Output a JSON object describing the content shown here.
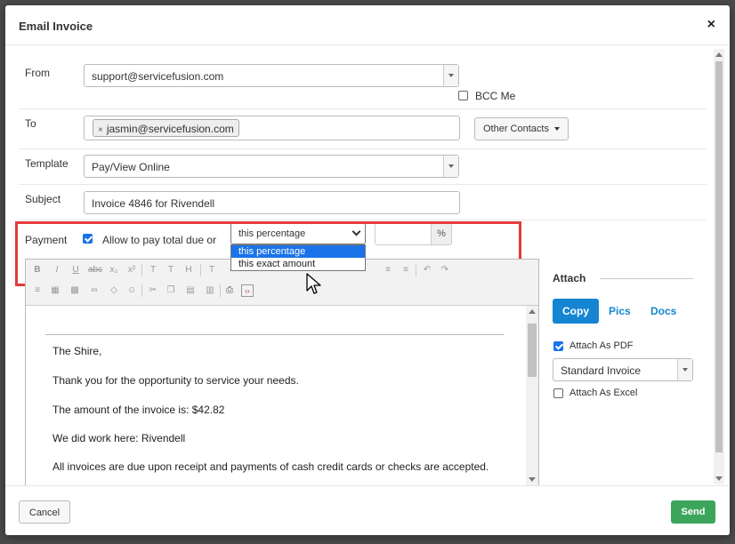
{
  "modal": {
    "title": "Email Invoice",
    "close_glyph": "×"
  },
  "from": {
    "label": "From",
    "value": "support@servicefusion.com",
    "bcc_label": "BCC Me",
    "bcc_checked": false
  },
  "to": {
    "label": "To",
    "recipient": "jasmin@servicefusion.com",
    "remove_glyph": "×",
    "other_contacts_label": "Other Contacts"
  },
  "template": {
    "label": "Template",
    "value": "Pay/View Online"
  },
  "subject": {
    "label": "Subject",
    "value": "Invoice 4846 for Rivendell"
  },
  "payment": {
    "label": "Payment",
    "allow_label": "Allow to pay total due or",
    "allow_checked": true,
    "mode_selected": "this percentage",
    "mode_options": [
      "this percentage",
      "this exact amount"
    ],
    "amount_value": "",
    "percent_addon": "%"
  },
  "editor": {
    "paragraphs": [
      "The Shire,",
      "Thank you for the opportunity to service your needs.",
      "The amount of the invoice is: $42.82",
      "We did work here: Rivendell",
      "All invoices are due upon receipt and payments of cash credit cards or checks are accepted."
    ]
  },
  "attach": {
    "title": "Attach",
    "tabs": [
      "Copy",
      "Pics",
      "Docs"
    ],
    "active_tab": "Copy",
    "attach_pdf_label": "Attach As PDF",
    "attach_pdf_checked": true,
    "pdf_template": "Standard Invoice",
    "attach_excel_label": "Attach As Excel",
    "attach_excel_checked": false
  },
  "footer": {
    "cancel_label": "Cancel",
    "send_label": "Send"
  },
  "colors": {
    "primary": "#1585d2",
    "success": "#3ca55c",
    "highlight": "#e53b3b",
    "option_active": "#1a73e8"
  }
}
